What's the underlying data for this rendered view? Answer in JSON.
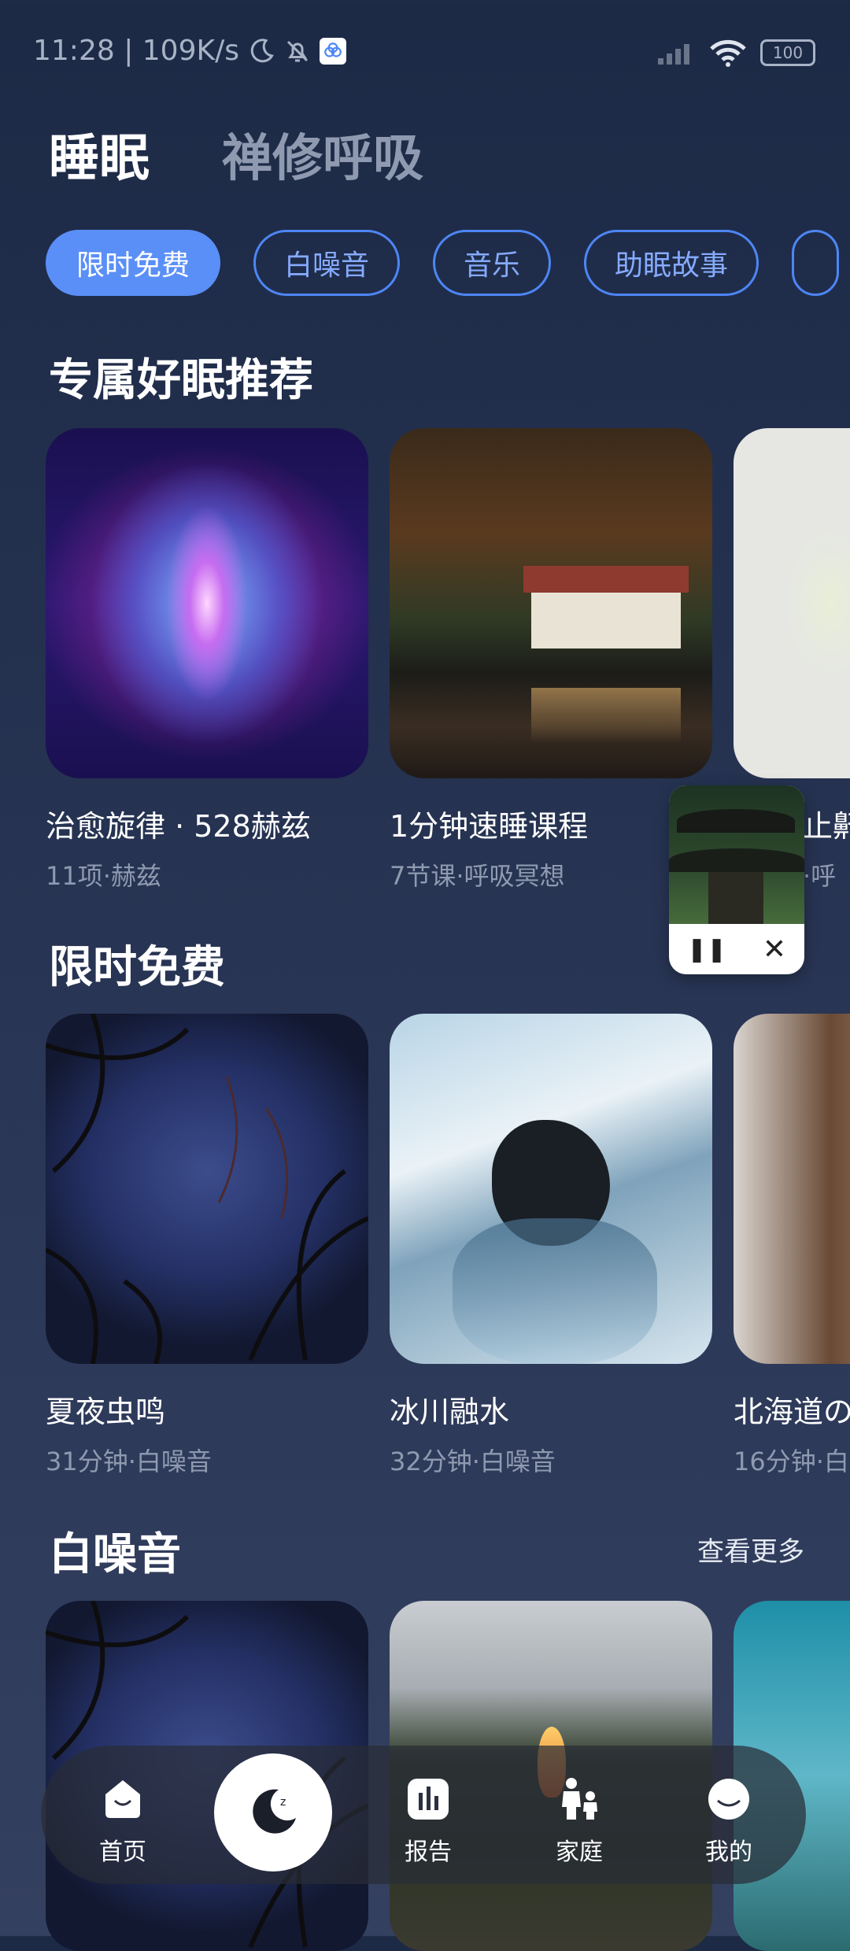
{
  "status_bar": {
    "time_speed": "11:28 | 109K/s",
    "battery": "100"
  },
  "main_tabs": [
    {
      "label": "睡眠"
    },
    {
      "label": "禅修呼吸"
    }
  ],
  "chips": [
    {
      "label": "限时免费"
    },
    {
      "label": "白噪音"
    },
    {
      "label": "音乐"
    },
    {
      "label": "助眠故事"
    }
  ],
  "sections": {
    "recommend": {
      "title": "专属好眠推荐",
      "cards": [
        {
          "title": "治愈旋律 · 528赫兹",
          "sub": "11项·赫兹"
        },
        {
          "title": "1分钟速睡课程",
          "sub": "7节课·呼吸冥想"
        },
        {
          "title": "止鼾",
          "sub": "·呼"
        }
      ]
    },
    "free": {
      "title": "限时免费",
      "cards": [
        {
          "title": "夏夜虫鸣",
          "sub": "31分钟·白噪音"
        },
        {
          "title": "冰川融水",
          "sub": "32分钟·白噪音"
        },
        {
          "title": "北海道の",
          "sub": "16分钟·白"
        }
      ]
    },
    "noise": {
      "title": "白噪音",
      "more": "查看更多"
    }
  },
  "mini_player": {
    "pause_icon": "pause-icon",
    "close_icon": "close-icon"
  },
  "bottom_nav": [
    {
      "label": "首页",
      "icon": "home-icon"
    },
    {
      "label": "",
      "icon": "sleep-moon-icon"
    },
    {
      "label": "报告",
      "icon": "report-icon"
    },
    {
      "label": "家庭",
      "icon": "family-icon"
    },
    {
      "label": "我的",
      "icon": "profile-icon"
    }
  ],
  "colors": {
    "accent": "#5a8ff7",
    "chip_border": "#4d86f5",
    "background_top": "#1c2a46",
    "background_bottom": "#34405f"
  }
}
